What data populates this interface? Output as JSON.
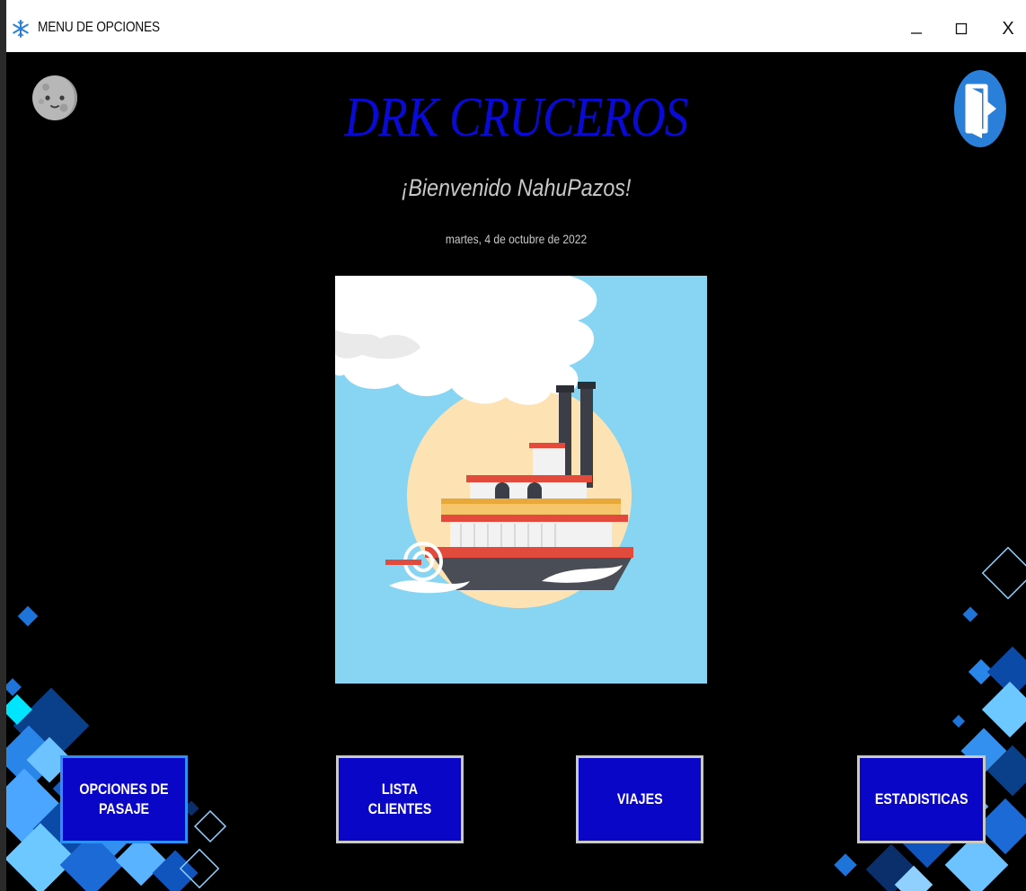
{
  "window": {
    "title": "MENU DE OPCIONES",
    "min_icon": "minimize-icon",
    "max_icon": "maximize-icon",
    "close_label": "X"
  },
  "header": {
    "brand": "DRK CRUCEROS",
    "welcome": "¡Bienvenido NahuPazos!",
    "date": "martes, 4 de octubre de 2022"
  },
  "icons": {
    "app": "snowflake-icon",
    "theme": "moon-icon",
    "logout": "exit-door-icon"
  },
  "menu": {
    "pasaje": "OPCIONES DE PASAJE",
    "clientes": "LISTA CLIENTES",
    "viajes": "VIAJES",
    "estadisticas": "ESTADISTICAS"
  },
  "colors": {
    "brand": "#0a0ad6",
    "button_bg": "#0a06c8",
    "background": "#000000"
  }
}
